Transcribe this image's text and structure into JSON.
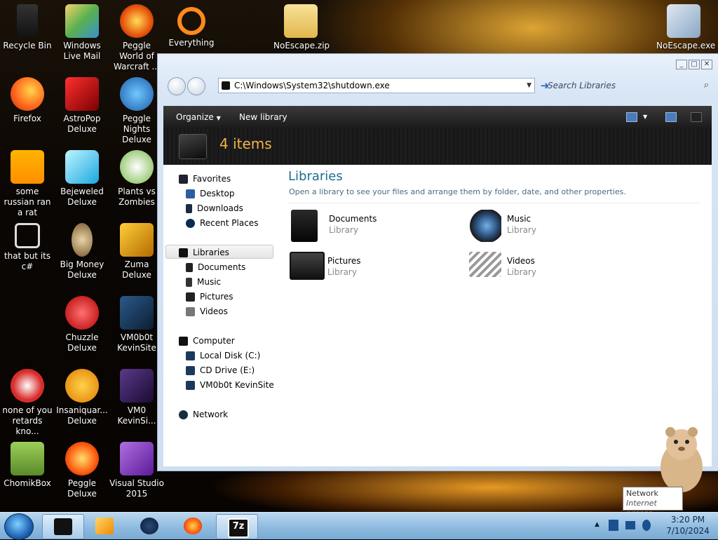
{
  "desktop": {
    "icons": [
      {
        "label": "Recycle Bin",
        "icon": "recycle-bin-icon"
      },
      {
        "label": "Windows Live Mail",
        "icon": "mail-icon"
      },
      {
        "label": "Peggle World of Warcraft ...",
        "icon": "game-icon"
      },
      {
        "label": "Everything",
        "icon": "search-app-icon"
      },
      {
        "label": "NoEscape.zip",
        "icon": "zip-folder-icon"
      },
      {
        "label": "NoEscape.exe",
        "icon": "exe-icon"
      },
      {
        "label": "Firefox",
        "icon": "firefox-icon"
      },
      {
        "label": "AstroPop Deluxe",
        "icon": "game-icon"
      },
      {
        "label": "Peggle Nights Deluxe",
        "icon": "game-icon"
      },
      {
        "label": "some russian ran a rat",
        "icon": "file-icon"
      },
      {
        "label": "Bejeweled Deluxe",
        "icon": "game-icon"
      },
      {
        "label": "Plants vs Zombies",
        "icon": "game-icon"
      },
      {
        "label": "that but its c#",
        "icon": "file-icon"
      },
      {
        "label": "Big Money Deluxe",
        "icon": "game-icon"
      },
      {
        "label": "Zuma Deluxe",
        "icon": "game-icon"
      },
      {
        "label": "Chuzzle Deluxe",
        "icon": "game-icon"
      },
      {
        "label": "VM0b0t KevinSite",
        "icon": "file-icon"
      },
      {
        "label": "none of you retards kno...",
        "icon": "file-icon"
      },
      {
        "label": "Insaniquar... Deluxe",
        "icon": "game-icon"
      },
      {
        "label": "VM0 KevinSi...",
        "icon": "file-icon"
      },
      {
        "label": "ChomikBox",
        "icon": "app-icon"
      },
      {
        "label": "Peggle Deluxe",
        "icon": "game-icon"
      },
      {
        "label": "Visual Studio 2015",
        "icon": "visual-studio-icon"
      }
    ]
  },
  "window": {
    "controls": [
      "_",
      "□",
      "✕"
    ],
    "address": "C:\\Windows\\System32\\shutdown.exe",
    "search_placeholder": "Search Libraries",
    "toolbar": {
      "organize": "Organize",
      "new_library": "New library"
    },
    "header_count": "4 items",
    "nav": {
      "favorites": "Favorites",
      "desktop": "Desktop",
      "downloads": "Downloads",
      "recent_places": "Recent Places",
      "libraries": "Libraries",
      "documents": "Documents",
      "music": "Music",
      "pictures": "Pictures",
      "videos": "Videos",
      "computer": "Computer",
      "local_disk": "Local Disk (C:)",
      "cd_drive": "CD Drive (E:)",
      "vm_site": "VM0b0t KevinSite",
      "network": "Network"
    },
    "libraries": {
      "title": "Libraries",
      "description": "Open a library to see your files and arrange them by folder, date, and other properties.",
      "items": [
        {
          "name": "Documents",
          "type": "Library"
        },
        {
          "name": "Music",
          "type": "Library"
        },
        {
          "name": "Pictures",
          "type": "Library"
        },
        {
          "name": "Videos",
          "type": "Library"
        }
      ]
    }
  },
  "taskbar": {
    "time": "3:20 PM",
    "date": "7/10/2024",
    "tooltip_title": "Network",
    "tooltip_sub": "Internet access"
  },
  "colors": {
    "accent_header": "#f3b44a",
    "libraries_title": "#1b6e92",
    "taskbar": "#8fbbe0"
  }
}
